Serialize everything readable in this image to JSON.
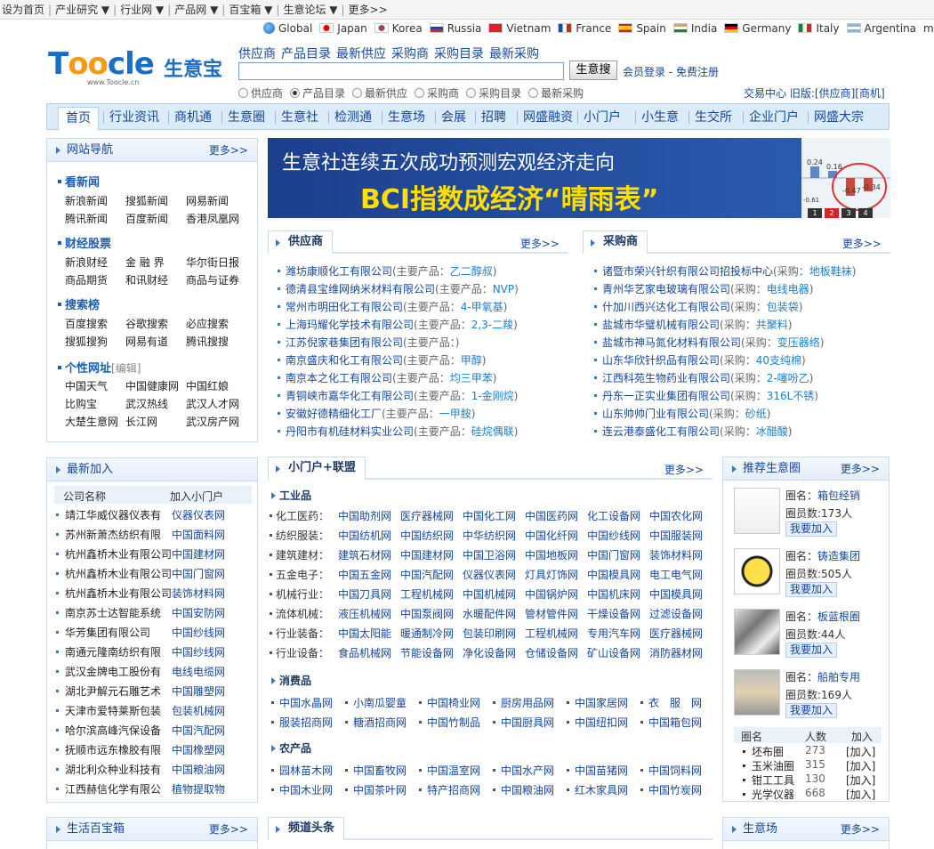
{
  "topbar": [
    "设为首页",
    "产业研究 ▼",
    "行业网 ▼",
    "产品网 ▼",
    "百宝箱 ▼",
    "生意论坛 ▼",
    "更多>>"
  ],
  "countries": [
    {
      "name": "Global",
      "flag": "globe"
    },
    {
      "name": "Japan",
      "flag": "jp"
    },
    {
      "name": "Korea",
      "flag": "kr"
    },
    {
      "name": "Russia",
      "flag": "ru"
    },
    {
      "name": "Vietnam",
      "flag": "vn"
    },
    {
      "name": "France",
      "flag": "fr"
    },
    {
      "name": "Spain",
      "flag": "es"
    },
    {
      "name": "India",
      "flag": "in"
    },
    {
      "name": "Germany",
      "flag": "de"
    },
    {
      "name": "Italy",
      "flag": "it"
    },
    {
      "name": "Argentina",
      "flag": "ar"
    }
  ],
  "countries_more": "more",
  "logo": {
    "text_a": "T",
    "text_b": "oo",
    "text_c": "cle",
    "cn": "生意宝",
    "url": "www.Toocle.cn"
  },
  "search": {
    "links": [
      "供应商",
      "产品目录",
      "最新供应",
      "采购商",
      "采购目录",
      "最新采购"
    ],
    "button": "生意搜",
    "login": "会员登录",
    "register": "免费注册",
    "radios": [
      "供应商",
      "产品目录",
      "最新供应",
      "采购商",
      "采购目录",
      "最新采购"
    ],
    "selected_radio": "产品目录",
    "trade_center": "交易中心",
    "old_label": "旧版:",
    "old_supplier": "[供应商]",
    "old_merchant": "[商机]"
  },
  "nav": [
    "首页",
    "行业资讯",
    "商机通",
    "生意圈",
    "生意社",
    "检测通",
    "生意场",
    "会展",
    "招聘",
    "网盛融资",
    "小门户",
    "小生意",
    "生交所",
    "企业门户",
    "网盛大宗"
  ],
  "site_nav": {
    "title": "网站导航",
    "more": "更多>>",
    "sections": [
      {
        "title": "看新闻",
        "links": [
          "新浪新闻",
          "搜狐新闻",
          "网易新闻",
          "腾讯新闻",
          "百度新闻",
          "香港凤凰网"
        ]
      },
      {
        "title": "财经股票",
        "links": [
          "新浪财经",
          "金 融 界",
          "华尔街日报",
          "商品期货",
          "和讯财经",
          "商品与证券"
        ]
      },
      {
        "title": "搜索榜",
        "links": [
          "百度搜索",
          "谷歌搜索",
          "必应搜索",
          "搜狐搜狗",
          "网易有道",
          "腾讯搜搜"
        ]
      },
      {
        "title": "个性网址",
        "edit": "[编辑]",
        "links": [
          "中国天气",
          "中国健康网",
          "中国红娘",
          "比购宝",
          "武汉热线",
          "武汉人才网",
          "大楚生意网",
          "长江网",
          "武汉房产网"
        ]
      }
    ]
  },
  "banner": {
    "line1": "生意社连续五次成功预测宏观经济走向",
    "line2": "BCI指数成经济“晴雨表”",
    "chart_vals": [
      "0.24",
      "0.16",
      "-0.47",
      "-0.34",
      "-0.61"
    ],
    "pages": [
      "1",
      "2",
      "3",
      "4"
    ],
    "active_page": "2"
  },
  "suppliers": {
    "title": "供应商",
    "more": "更多>>",
    "main_label": "(主要产品：",
    "items": [
      {
        "name": "潍坊康顺化工有限公司",
        "product": "乙二醇叔"
      },
      {
        "name": "德清县宝维网纳米材料有限公司",
        "product": "NVP"
      },
      {
        "name": "常州市明田化工有限公司",
        "product": "4-甲氧基"
      },
      {
        "name": "上海玛耀化学技术有限公司",
        "product": "2,3-二羧"
      },
      {
        "name": "江苏倪家巷集团有限公司",
        "product": ""
      },
      {
        "name": "南京盛庆和化工有限公司",
        "product": "甲醇"
      },
      {
        "name": "南京本之化工有限公司",
        "product": "均三甲苯"
      },
      {
        "name": "青铜峡市嘉华化工有限公司",
        "product": "1-金刚烷"
      },
      {
        "name": "安徽好德精细化工厂",
        "product": "一甲胺"
      },
      {
        "name": "丹阳市有机硅材料实业公司",
        "product": "硅烷偶联"
      }
    ]
  },
  "buyers": {
    "title": "采购商",
    "more": "更多>>",
    "main_label": "(采购：",
    "items": [
      {
        "name": "诸暨市荣兴针织有限公司招投标中心",
        "product": "地板鞋袜"
      },
      {
        "name": "青州华艺家电玻璃有限公司",
        "product": "电线电器"
      },
      {
        "name": "什加川西兴达化工有限公司",
        "product": "包装袋"
      },
      {
        "name": "盐城市华璧机械有限公司",
        "product": "共聚料"
      },
      {
        "name": "盐城市神马氮化材料有限公司",
        "product": "变压器络"
      },
      {
        "name": "山东华欣针织品有限公司",
        "product": "40支纯棉"
      },
      {
        "name": "江西科苑生物药业有限公司",
        "product": "2-噻吩乙"
      },
      {
        "name": "丹东一正实业集团有限公司",
        "product": "316L不锈"
      },
      {
        "name": "山东帅帅门业有限公司",
        "product": "砂纸"
      },
      {
        "name": "连云港泰盛化工有限公司",
        "product": "冰醋酸"
      }
    ]
  },
  "new_joins": {
    "title": "最新加入",
    "col1": "公司名称",
    "col2": "加入小门户",
    "rows": [
      [
        "靖江华威仪器仪表有",
        "仪器仪表网"
      ],
      [
        "苏州新萧杰纺织有限",
        "中国面料网"
      ],
      [
        "杭州鑫桥木业有限公司",
        "中国建材网"
      ],
      [
        "杭州鑫桥木业有限公司",
        "中国门窗网"
      ],
      [
        "杭州鑫桥木业有限公司",
        "装饰材料网"
      ],
      [
        "南京苏士达智能系统",
        "中国安防网"
      ],
      [
        "华芳集团有限公司",
        "中国纱线网"
      ],
      [
        "南通元隆南纺织有限",
        "中国纱线网"
      ],
      [
        "武汉金牌电工股份有",
        "电线电缆网"
      ],
      [
        "湖北尹解元石雕艺术",
        "中国雕塑网"
      ],
      [
        "天津市爱特莱斯包装",
        "包装机械网"
      ],
      [
        "哈尔滨高峰汽保设备",
        "中国汽配网"
      ],
      [
        "抚顺市远东橡胶有限",
        "中国橡塑网"
      ],
      [
        "湖北利众种业科技有",
        "中国粮油网"
      ],
      [
        "江西赫信化学有限公",
        "植物提取物"
      ]
    ]
  },
  "portal": {
    "title": "小门户+联盟",
    "more": "更多>>",
    "industry_title": "工业品",
    "industry": [
      {
        "label": "化工医药：",
        "links": [
          "中国助剂网",
          "医疗器械网",
          "中国化工网",
          "中国医药网",
          "化工设备网",
          "中国农化网"
        ]
      },
      {
        "label": "纺织服装：",
        "links": [
          "中国纺机网",
          "中国纺织网",
          "中华纺织网",
          "中国化纤网",
          "中国纱线网",
          "中国服装网"
        ]
      },
      {
        "label": "建筑建材：",
        "links": [
          "建筑石材网",
          "中国建材网",
          "中国卫浴网",
          "中国地板网",
          "中国门窗网",
          "装饰材料网"
        ]
      },
      {
        "label": "五金电子：",
        "links": [
          "中国五金网",
          "中国汽配网",
          "仪器仪表网",
          "灯具灯饰网",
          "中国模具网",
          "电工电气网"
        ]
      },
      {
        "label": "机械行业：",
        "links": [
          "中国刀具网",
          "工程机械网",
          "中国机械网",
          "中国锅炉网",
          "中国机床网",
          "中国模具网"
        ]
      },
      {
        "label": "流体机械：",
        "links": [
          "液压机械网",
          "中国泵阀网",
          "水暖配件网",
          "管材管件网",
          "干燥设备网",
          "过滤设备网"
        ]
      },
      {
        "label": "行业装备：",
        "links": [
          "中国太阳能",
          "暖通制冷网",
          "包装印刷网",
          "工程机械网",
          "专用汽车网",
          "医疗器械网"
        ]
      },
      {
        "label": "行业设备：",
        "links": [
          "食品机械网",
          "节能设备网",
          "净化设备网",
          "仓储设备网",
          "矿山设备网",
          "消防器材网"
        ]
      }
    ],
    "consumer_title": "消费品",
    "consumer": [
      [
        "中国水晶网",
        "小南瓜婴童",
        "中国椅业网",
        "厨房用品网",
        "中国家居网",
        "衣　服　网"
      ],
      [
        "服装招商网",
        "糖酒招商网",
        "中国竹制品",
        "中国厨具网",
        "中国纽扣网",
        "中国箱包网"
      ]
    ],
    "agri_title": "农产品",
    "agri": [
      [
        "园林苗木网",
        "中国畜牧网",
        "中国温室网",
        "中国水产网",
        "中国苗猪网",
        "中国饲料网"
      ],
      [
        "中国木业网",
        "中国茶叶网",
        "特产招商网",
        "中国粮油网",
        "红木家具网",
        "中国竹炭网"
      ]
    ]
  },
  "circles": {
    "title": "推荐生意圈",
    "more": "更多>>",
    "name_label": "圈名：",
    "members_label": "圈员数:",
    "join": "我要加入",
    "items": [
      {
        "name": "箱包经销",
        "members": "173人"
      },
      {
        "name": "铸造集团",
        "members": "505人"
      },
      {
        "name": "板蓝根圈",
        "members": "44人"
      },
      {
        "name": "船舶专用",
        "members": "169人"
      }
    ],
    "table_headers": [
      "圈名",
      "人数",
      "加入"
    ],
    "table_rows": [
      [
        "坯布圈",
        "273",
        "[加入]"
      ],
      [
        "玉米油圈",
        "315",
        "[加入]"
      ],
      [
        "钳工工具",
        "130",
        "[加入]"
      ],
      [
        "光学仪器",
        "668",
        "[加入]"
      ]
    ]
  },
  "bottom": {
    "life": "生活百宝箱",
    "life_more": "更多>>",
    "headline": "频道头条",
    "market": "生意场",
    "market_more": "更多>>"
  }
}
